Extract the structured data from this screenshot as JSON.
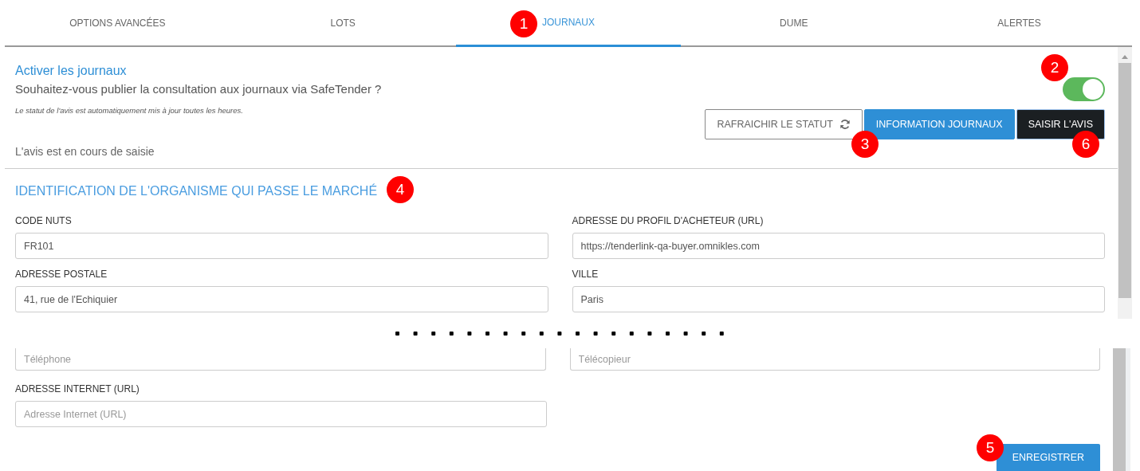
{
  "tabs": [
    {
      "label": "OPTIONS AVANCÉES",
      "selected": false
    },
    {
      "label": "LOTS",
      "selected": false
    },
    {
      "label": "JOURNAUX",
      "selected": true
    },
    {
      "label": "DUME",
      "selected": false
    },
    {
      "label": "ALERTES",
      "selected": false
    }
  ],
  "journaux": {
    "title": "Activer les journaux",
    "question": "Souhaitez-vous publier la consultation aux journaux via SafeTender ?",
    "note": "Le statut de l'avis est automatiquement mis à jour toutes les heures.",
    "toggle": {
      "on": true
    },
    "status": "L'avis est en cours de saisie",
    "buttons": [
      {
        "label": "RAFRAICHIR LE STATUT",
        "kind": "outline"
      },
      {
        "label": "INFORMATION JOURNAUX",
        "kind": "primary"
      },
      {
        "label": "SAISIR L'AVIS",
        "kind": "dark"
      }
    ]
  },
  "section": {
    "title": "IDENTIFICATION DE L'ORGANISME QUI PASSE LE MARCHÉ",
    "fields": [
      {
        "label": "CODE NUTS",
        "value": "FR101"
      },
      {
        "label": "ADRESSE DU PROFIL D'ACHETEUR (URL)",
        "value": "https://tenderlink-qa-buyer.omnikles.com"
      },
      {
        "label": "ADRESSE POSTALE",
        "value": "41, rue de l'Echiquier"
      },
      {
        "label": "VILLE",
        "value": "Paris"
      }
    ]
  },
  "continued": {
    "fields": [
      {
        "placeholder": "Téléphone"
      },
      {
        "placeholder": "Télécopieur"
      },
      {
        "label": "ADRESSE INTERNET (URL)",
        "placeholder": "Adresse Internet (URL)"
      }
    ],
    "save_button": "ENREGISTRER"
  },
  "callouts": [
    "1",
    "2",
    "3",
    "4",
    "5",
    "6"
  ]
}
